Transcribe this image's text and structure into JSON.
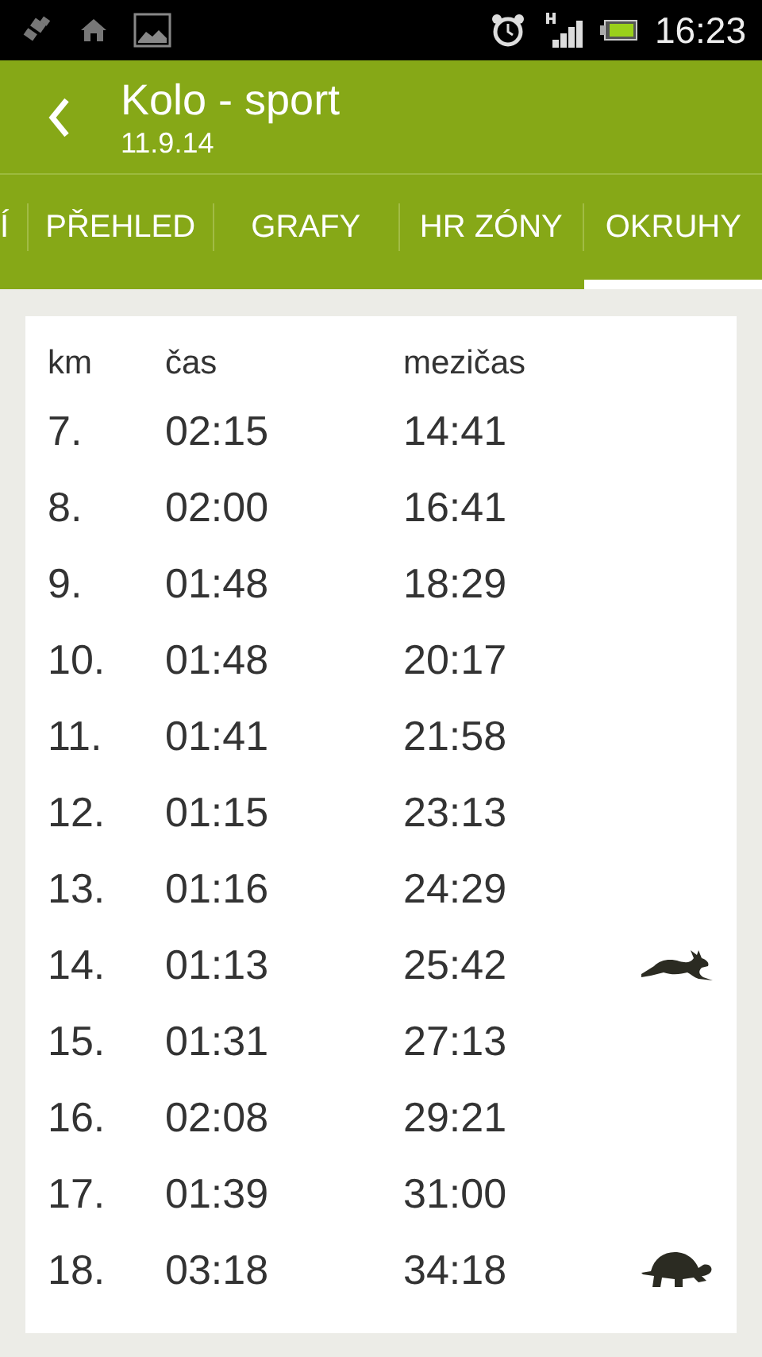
{
  "status_bar": {
    "time": "16:23"
  },
  "header": {
    "title": "Kolo - sport",
    "subtitle": "11.9.14"
  },
  "tabs": [
    {
      "label": "Í",
      "selected": false
    },
    {
      "label": "PŘEHLED",
      "selected": false
    },
    {
      "label": "GRAFY",
      "selected": false
    },
    {
      "label": "HR ZÓNY",
      "selected": false
    },
    {
      "label": "OKRUHY",
      "selected": true
    }
  ],
  "table": {
    "columns": [
      "km",
      "čas",
      "mezičas"
    ],
    "rows": [
      {
        "km": "7.",
        "time": "02:15",
        "split": "14:41"
      },
      {
        "km": "8.",
        "time": "02:00",
        "split": "16:41"
      },
      {
        "km": "9.",
        "time": "01:48",
        "split": "18:29"
      },
      {
        "km": "10.",
        "time": "01:48",
        "split": "20:17"
      },
      {
        "km": "11.",
        "time": "01:41",
        "split": "21:58"
      },
      {
        "km": "12.",
        "time": "01:15",
        "split": "23:13"
      },
      {
        "km": "13.",
        "time": "01:16",
        "split": "24:29"
      },
      {
        "km": "14.",
        "time": "01:13",
        "split": "25:42",
        "kind": "fastest"
      },
      {
        "km": "15.",
        "time": "01:31",
        "split": "27:13"
      },
      {
        "km": "16.",
        "time": "02:08",
        "split": "29:21"
      },
      {
        "km": "17.",
        "time": "01:39",
        "split": "31:00"
      },
      {
        "km": "18.",
        "time": "03:18",
        "split": "34:18",
        "kind": "slowest"
      }
    ]
  }
}
